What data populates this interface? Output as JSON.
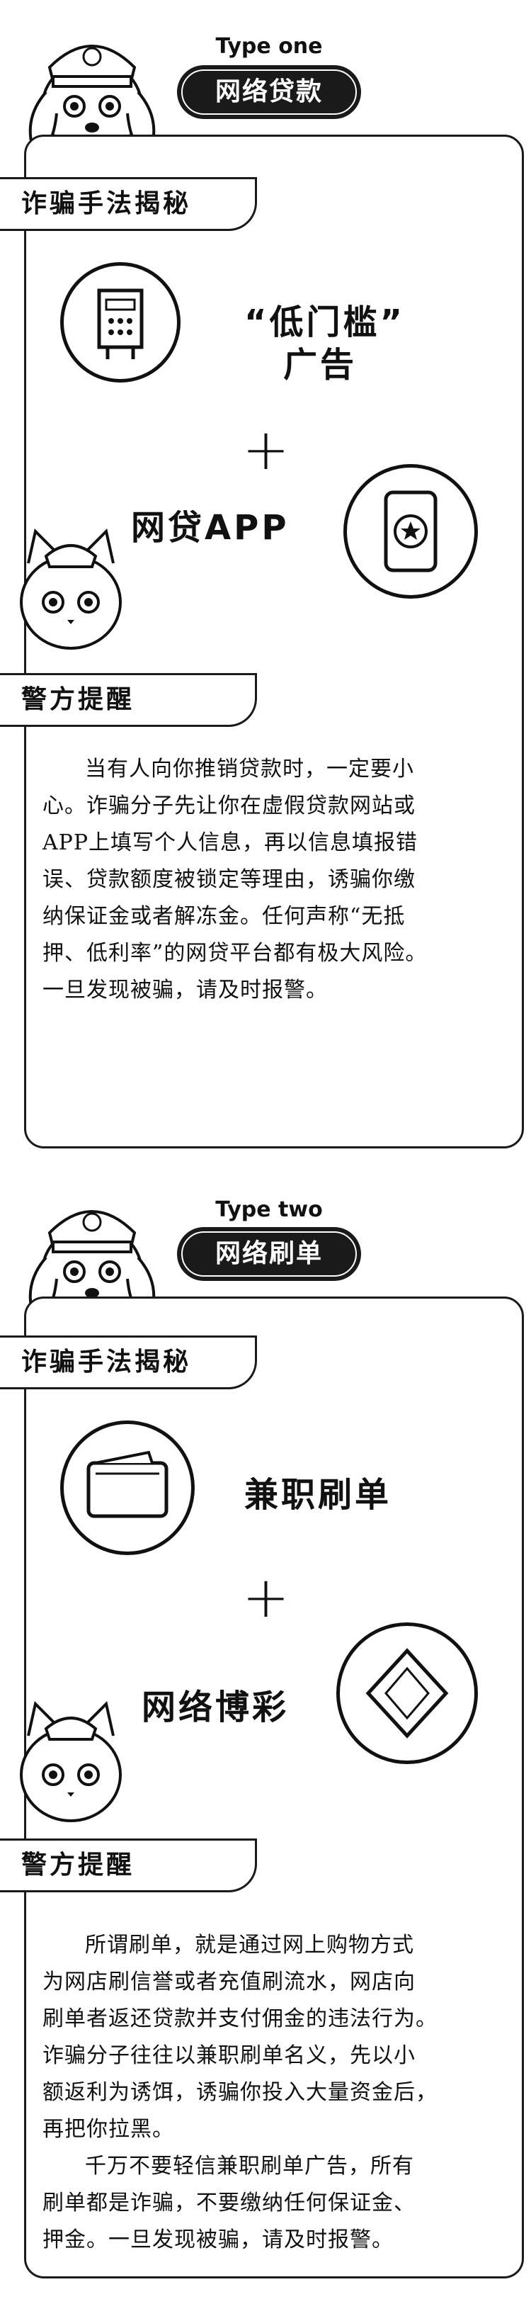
{
  "section1": {
    "type_label": "Type one",
    "title": "网络贷款",
    "method_tag": "诈骗手法揭秘",
    "ad_label_line1": "“低门槛”",
    "ad_label_line2": "广告",
    "plus": "+",
    "app_label": "网贷APP",
    "warning_tag": "警方提醒",
    "warning_text": "当有人向你推销贷款时，一定要小\n心。诈骗分子先让你在虚假贷款网站或\nAPP上填写个人信息，再以信息填报错\n误、贷款额度被锁定等理由，诱骗你缴\n纳保证金或者解冻金。任何声称“无抵\n押、低利率”的网贷平台都有极大风险。\n一旦发现被骗，请及时报警。"
  },
  "section2": {
    "type_label": "Type two",
    "title": "网络刷单",
    "method_tag": "诈骗手法揭秘",
    "job_label": "兼职刷单",
    "plus": "+",
    "gamble_label": "网络博彩",
    "warning_tag": "警方提醒",
    "warning_text_1": "所谓刷单，就是通过网上购物方式\n为网店刷信誉或者充值刷流水，网店向\n刷单者返还贷款并支付佣金的违法行为。\n诈骗分子往往以兼职刷单名义，先以小\n额返利为诱饵，诱骗你投入大量资金后，\n再把你拉黑。",
    "warning_text_2": "千万不要轻信兼职刷单广告，所有\n刷单都是诈骗，不要缴纳任何保证金、\n押金。一旦发现被骗，请及时报警。"
  }
}
